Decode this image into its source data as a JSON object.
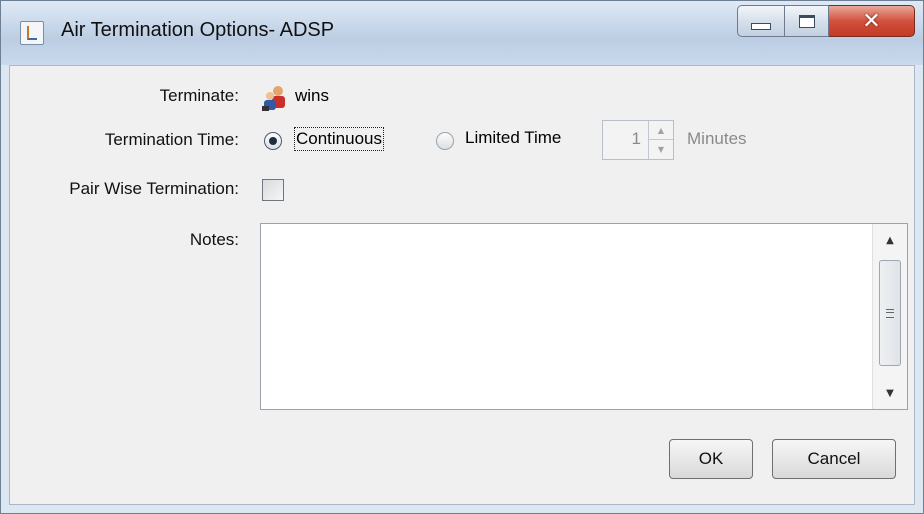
{
  "window": {
    "title": "Air Termination Options- ADSP",
    "icon": "java-cup-icon",
    "controls": [
      "minimize-icon",
      "maximize-icon",
      "close-icon"
    ]
  },
  "form": {
    "terminate_label": "Terminate:",
    "terminate_value": "wins",
    "terminate_icon": "users-icon",
    "termination_time_label": "Termination Time:",
    "continuous_label": "Continuous",
    "continuous_selected": true,
    "limited_time_label": "Limited Time",
    "limited_time_selected": false,
    "minutes_value": "1",
    "minutes_label": "Minutes",
    "pair_wise_label": "Pair Wise Termination:",
    "pair_wise_checked": false,
    "notes_label": "Notes:",
    "notes_value": ""
  },
  "buttons": {
    "ok": "OK",
    "cancel": "Cancel"
  }
}
